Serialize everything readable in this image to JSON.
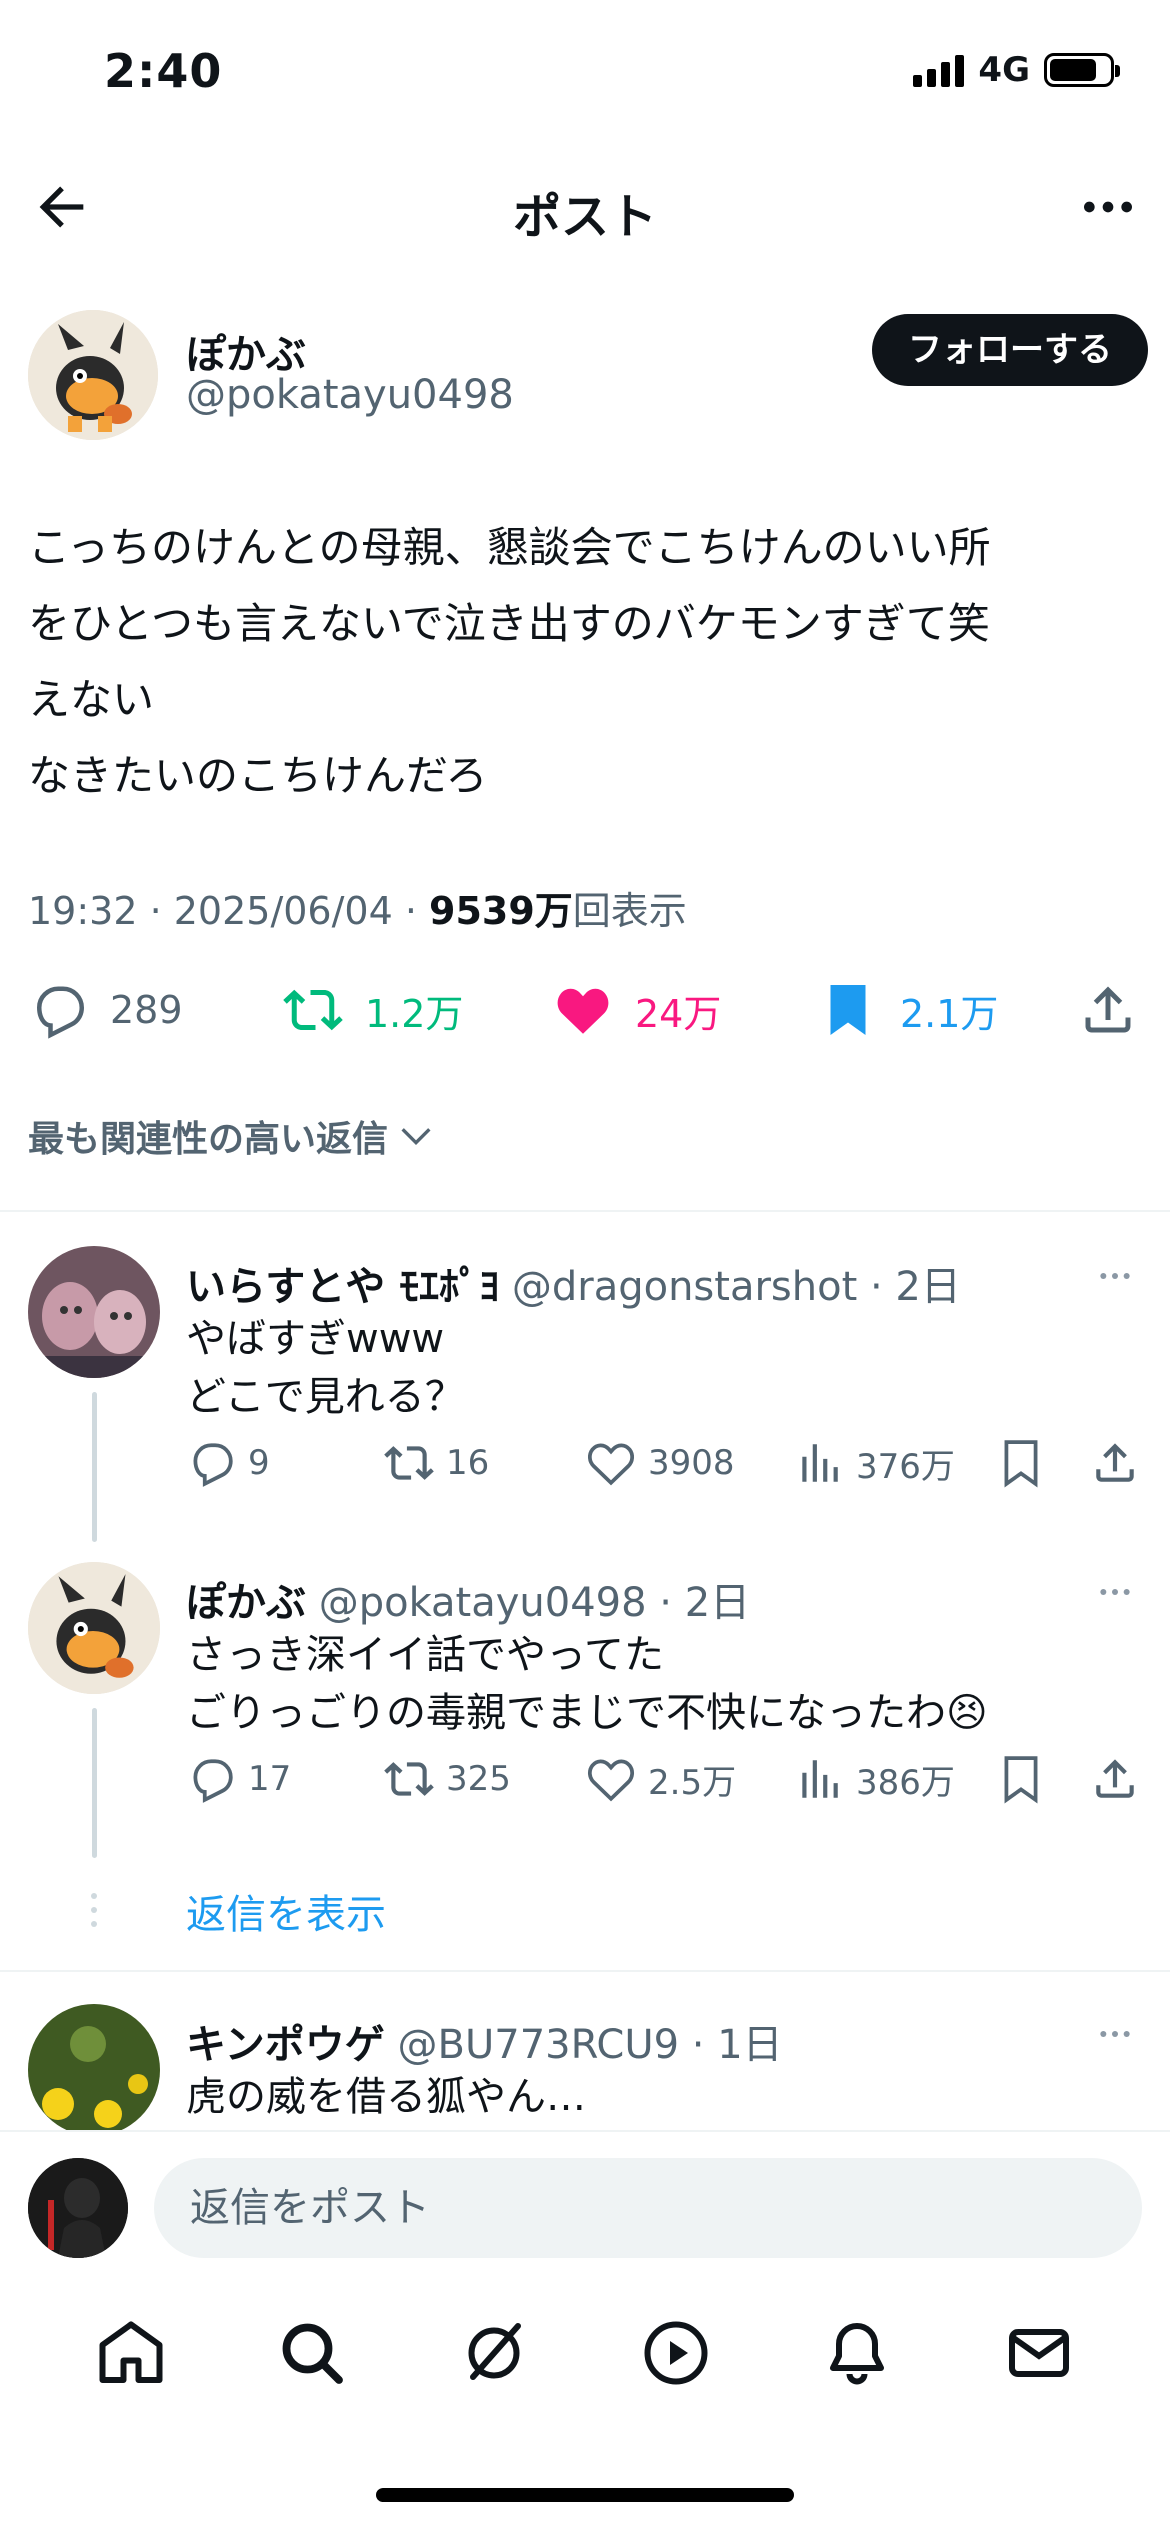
{
  "status": {
    "time": "2:40",
    "network": "4G"
  },
  "nav": {
    "title": "ポスト"
  },
  "post": {
    "author_name": "ぽかぶ",
    "author_handle": "@pokatayu0498",
    "follow_label": "フォローする",
    "text": "こっちのけんとの母親、懇談会でこちけんのいい所\nをひとつも言えないで泣き出すのバケモンすぎて笑\nえない\nなきたいのこちけんだろ",
    "timestamp": "19:32 · 2025/06/04 · ",
    "views_count": "9539万",
    "views_label": "回表示",
    "replies": "289",
    "reposts": "1.2万",
    "likes": "24万",
    "bookmarks": "2.1万",
    "colors": {
      "repost": "#00ba7c",
      "like": "#f91880",
      "bookmark": "#1d9bf0"
    }
  },
  "sort_label": "最も関連性の高い返信",
  "replies": [
    {
      "name": "いらすとや ﾓｴﾎﾟﾖ",
      "handle": "@dragonstarshot",
      "time": "· 2日",
      "text": "やばすぎwww\nどこで見れる？",
      "replies": "9",
      "reposts": "16",
      "likes": "3908",
      "views": "376万"
    },
    {
      "name": "ぽかぶ",
      "handle": "@pokatayu0498",
      "time": "· 2日",
      "text": "さっき深イイ話でやってた\nごりっごりの毒親でまじで不快になったわ😣",
      "replies": "17",
      "reposts": "325",
      "likes": "2.5万",
      "views": "386万"
    },
    {
      "name": "キンポウゲ",
      "handle": "@BU773RCU9",
      "time": "· 1日",
      "text": "虎の威を借る狐やん…"
    }
  ],
  "show_replies_label": "返信を表示",
  "composer": {
    "placeholder": "返信をポスト"
  }
}
